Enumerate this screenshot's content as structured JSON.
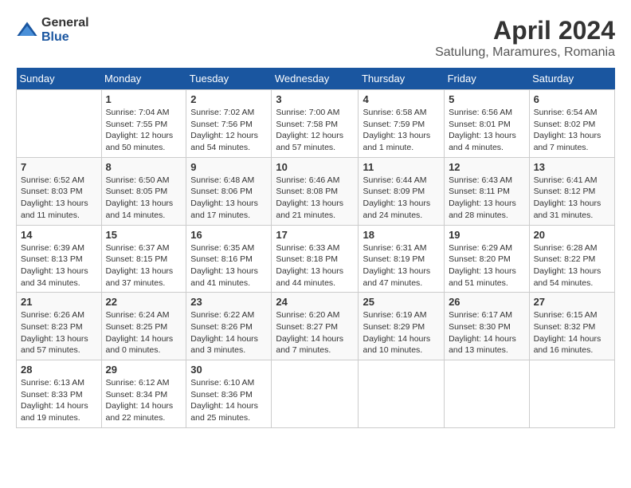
{
  "logo": {
    "general": "General",
    "blue": "Blue"
  },
  "title": "April 2024",
  "subtitle": "Satulung, Maramures, Romania",
  "days_header": [
    "Sunday",
    "Monday",
    "Tuesday",
    "Wednesday",
    "Thursday",
    "Friday",
    "Saturday"
  ],
  "weeks": [
    [
      {
        "num": "",
        "info": ""
      },
      {
        "num": "1",
        "info": "Sunrise: 7:04 AM\nSunset: 7:55 PM\nDaylight: 12 hours\nand 50 minutes."
      },
      {
        "num": "2",
        "info": "Sunrise: 7:02 AM\nSunset: 7:56 PM\nDaylight: 12 hours\nand 54 minutes."
      },
      {
        "num": "3",
        "info": "Sunrise: 7:00 AM\nSunset: 7:58 PM\nDaylight: 12 hours\nand 57 minutes."
      },
      {
        "num": "4",
        "info": "Sunrise: 6:58 AM\nSunset: 7:59 PM\nDaylight: 13 hours\nand 1 minute."
      },
      {
        "num": "5",
        "info": "Sunrise: 6:56 AM\nSunset: 8:01 PM\nDaylight: 13 hours\nand 4 minutes."
      },
      {
        "num": "6",
        "info": "Sunrise: 6:54 AM\nSunset: 8:02 PM\nDaylight: 13 hours\nand 7 minutes."
      }
    ],
    [
      {
        "num": "7",
        "info": "Sunrise: 6:52 AM\nSunset: 8:03 PM\nDaylight: 13 hours\nand 11 minutes."
      },
      {
        "num": "8",
        "info": "Sunrise: 6:50 AM\nSunset: 8:05 PM\nDaylight: 13 hours\nand 14 minutes."
      },
      {
        "num": "9",
        "info": "Sunrise: 6:48 AM\nSunset: 8:06 PM\nDaylight: 13 hours\nand 17 minutes."
      },
      {
        "num": "10",
        "info": "Sunrise: 6:46 AM\nSunset: 8:08 PM\nDaylight: 13 hours\nand 21 minutes."
      },
      {
        "num": "11",
        "info": "Sunrise: 6:44 AM\nSunset: 8:09 PM\nDaylight: 13 hours\nand 24 minutes."
      },
      {
        "num": "12",
        "info": "Sunrise: 6:43 AM\nSunset: 8:11 PM\nDaylight: 13 hours\nand 28 minutes."
      },
      {
        "num": "13",
        "info": "Sunrise: 6:41 AM\nSunset: 8:12 PM\nDaylight: 13 hours\nand 31 minutes."
      }
    ],
    [
      {
        "num": "14",
        "info": "Sunrise: 6:39 AM\nSunset: 8:13 PM\nDaylight: 13 hours\nand 34 minutes."
      },
      {
        "num": "15",
        "info": "Sunrise: 6:37 AM\nSunset: 8:15 PM\nDaylight: 13 hours\nand 37 minutes."
      },
      {
        "num": "16",
        "info": "Sunrise: 6:35 AM\nSunset: 8:16 PM\nDaylight: 13 hours\nand 41 minutes."
      },
      {
        "num": "17",
        "info": "Sunrise: 6:33 AM\nSunset: 8:18 PM\nDaylight: 13 hours\nand 44 minutes."
      },
      {
        "num": "18",
        "info": "Sunrise: 6:31 AM\nSunset: 8:19 PM\nDaylight: 13 hours\nand 47 minutes."
      },
      {
        "num": "19",
        "info": "Sunrise: 6:29 AM\nSunset: 8:20 PM\nDaylight: 13 hours\nand 51 minutes."
      },
      {
        "num": "20",
        "info": "Sunrise: 6:28 AM\nSunset: 8:22 PM\nDaylight: 13 hours\nand 54 minutes."
      }
    ],
    [
      {
        "num": "21",
        "info": "Sunrise: 6:26 AM\nSunset: 8:23 PM\nDaylight: 13 hours\nand 57 minutes."
      },
      {
        "num": "22",
        "info": "Sunrise: 6:24 AM\nSunset: 8:25 PM\nDaylight: 14 hours\nand 0 minutes."
      },
      {
        "num": "23",
        "info": "Sunrise: 6:22 AM\nSunset: 8:26 PM\nDaylight: 14 hours\nand 3 minutes."
      },
      {
        "num": "24",
        "info": "Sunrise: 6:20 AM\nSunset: 8:27 PM\nDaylight: 14 hours\nand 7 minutes."
      },
      {
        "num": "25",
        "info": "Sunrise: 6:19 AM\nSunset: 8:29 PM\nDaylight: 14 hours\nand 10 minutes."
      },
      {
        "num": "26",
        "info": "Sunrise: 6:17 AM\nSunset: 8:30 PM\nDaylight: 14 hours\nand 13 minutes."
      },
      {
        "num": "27",
        "info": "Sunrise: 6:15 AM\nSunset: 8:32 PM\nDaylight: 14 hours\nand 16 minutes."
      }
    ],
    [
      {
        "num": "28",
        "info": "Sunrise: 6:13 AM\nSunset: 8:33 PM\nDaylight: 14 hours\nand 19 minutes."
      },
      {
        "num": "29",
        "info": "Sunrise: 6:12 AM\nSunset: 8:34 PM\nDaylight: 14 hours\nand 22 minutes."
      },
      {
        "num": "30",
        "info": "Sunrise: 6:10 AM\nSunset: 8:36 PM\nDaylight: 14 hours\nand 25 minutes."
      },
      {
        "num": "",
        "info": ""
      },
      {
        "num": "",
        "info": ""
      },
      {
        "num": "",
        "info": ""
      },
      {
        "num": "",
        "info": ""
      }
    ]
  ]
}
